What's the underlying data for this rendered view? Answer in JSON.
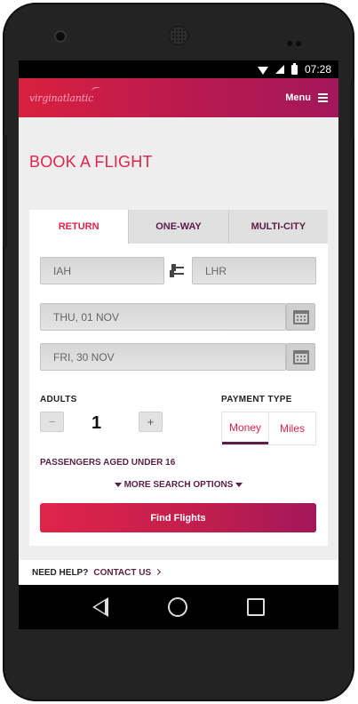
{
  "status_bar": {
    "time": "07:28"
  },
  "header": {
    "logo_text": "virginatlantic",
    "menu_label": "Menu"
  },
  "page": {
    "title": "BOOK A FLIGHT"
  },
  "tabs": [
    {
      "label": "RETURN",
      "active": true
    },
    {
      "label": "ONE-WAY",
      "active": false
    },
    {
      "label": "MULTI-CITY",
      "active": false
    }
  ],
  "search": {
    "origin": "IAH",
    "destination": "LHR",
    "departure_date": "THU, 01 NOV",
    "return_date": "FRI, 30 NOV"
  },
  "passengers": {
    "adults_label": "ADULTS",
    "adults_count": "1",
    "minus_label": "−",
    "plus_label": "+",
    "under16_link": "PASSENGERS AGED UNDER 16"
  },
  "payment": {
    "label": "PAYMENT TYPE",
    "options": [
      "Money",
      "Miles"
    ],
    "selected": "Money"
  },
  "more_options_label": "MORE SEARCH OPTIONS",
  "find_button_label": "Find Flights",
  "help": {
    "label": "NEED HELP?",
    "link": "CONTACT US"
  },
  "colors": {
    "brand_red": "#e0244a",
    "brand_purple": "#5b1e45"
  }
}
